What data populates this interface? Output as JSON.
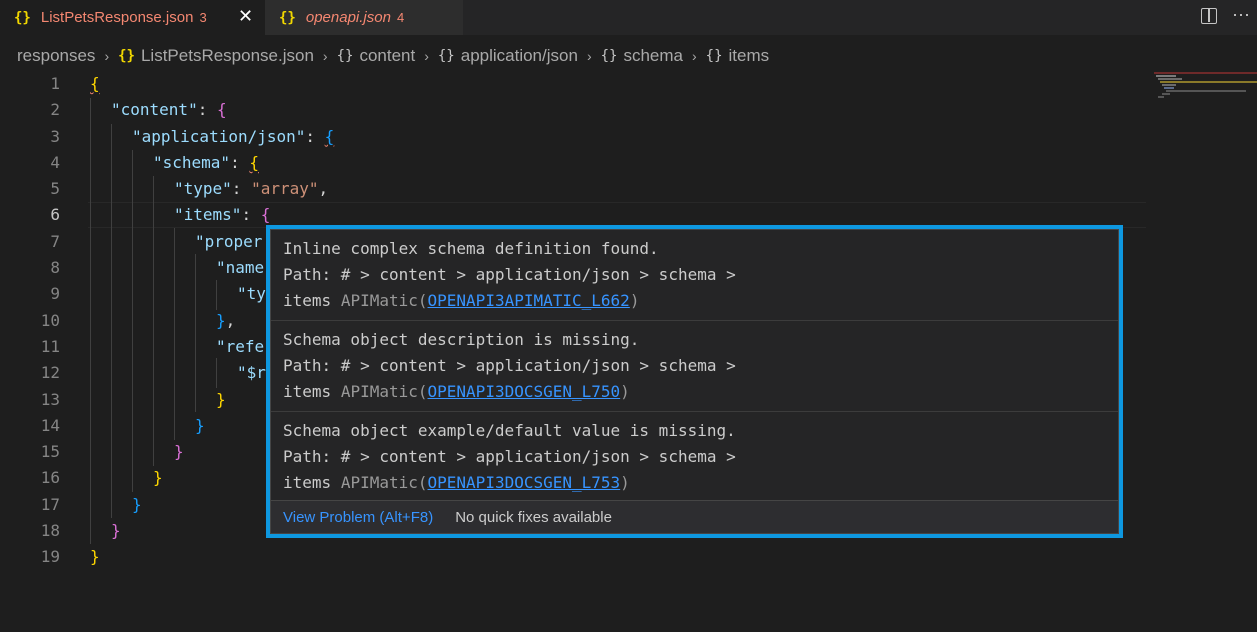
{
  "tabs": [
    {
      "icon": "{}",
      "name": "ListPetsResponse.json",
      "count": "3",
      "close": "✕"
    },
    {
      "icon": "{}",
      "name": "openapi.json",
      "count": "4"
    }
  ],
  "breadcrumb": {
    "items": [
      "responses",
      "ListPetsResponse.json",
      "content",
      "application/json",
      "schema",
      "items"
    ],
    "sep": "›",
    "file_icon": "{}",
    "obj_icon": "{}"
  },
  "editor": {
    "line_numbers": [
      "1",
      "2",
      "3",
      "4",
      "5",
      "6",
      "7",
      "8",
      "9",
      "10",
      "11",
      "12",
      "13",
      "14",
      "15",
      "16",
      "17",
      "18",
      "19"
    ],
    "current_line": "6",
    "lines": [
      [
        [
          "b1",
          "{"
        ]
      ],
      [
        [
          "key",
          "\"content\""
        ],
        [
          "punc",
          ": "
        ],
        [
          "b2",
          "{"
        ]
      ],
      [
        [
          "key",
          "\"application/json\""
        ],
        [
          "punc",
          ": "
        ],
        [
          "b3",
          "{"
        ]
      ],
      [
        [
          "key",
          "\"schema\""
        ],
        [
          "punc",
          ": "
        ],
        [
          "b1",
          "{"
        ]
      ],
      [
        [
          "key",
          "\"type\""
        ],
        [
          "punc",
          ": "
        ],
        [
          "str",
          "\"array\""
        ],
        [
          "punc",
          ","
        ]
      ],
      [
        [
          "key",
          "\"items\""
        ],
        [
          "punc",
          ": "
        ],
        [
          "b2",
          "{"
        ]
      ],
      [
        [
          "key",
          "\"proper"
        ]
      ],
      [
        [
          "key",
          "\"name"
        ]
      ],
      [
        [
          "key",
          "\"ty"
        ]
      ],
      [
        [
          "b3",
          "}"
        ],
        [
          "punc",
          ","
        ]
      ],
      [
        [
          "key",
          "\"refe"
        ]
      ],
      [
        [
          "key",
          "\"$r"
        ]
      ],
      [
        [
          "b1",
          "}"
        ]
      ],
      [
        [
          "b3",
          "}"
        ]
      ],
      [
        [
          "b2",
          "}"
        ]
      ],
      [
        [
          "b1",
          "}"
        ]
      ],
      [
        [
          "b3",
          "}"
        ]
      ],
      [
        [
          "b2",
          "}"
        ]
      ],
      [
        [
          "b1",
          "}"
        ]
      ]
    ]
  },
  "hover": {
    "problems": [
      {
        "message": "Inline complex schema definition found.",
        "path": "Path: # > content > application/json > schema >",
        "tail": "items",
        "source": "APIMatic",
        "code": "OPENAPI3APIMATIC_L662"
      },
      {
        "message": "Schema object description is missing.",
        "path": "Path: # > content > application/json > schema >",
        "tail": "items",
        "source": "APIMatic",
        "code": "OPENAPI3DOCSGEN_L750"
      },
      {
        "message": "Schema object example/default value is missing.",
        "path": "Path: # > content > application/json > schema >",
        "tail": "items",
        "source": "APIMatic",
        "code": "OPENAPI3DOCSGEN_L753"
      }
    ],
    "view_problem": "View Problem (Alt+F8)",
    "no_fixes": "No quick fixes available"
  },
  "colors": {
    "accent": "#0e98e0",
    "error": "#f48771",
    "link": "#3794ff"
  }
}
